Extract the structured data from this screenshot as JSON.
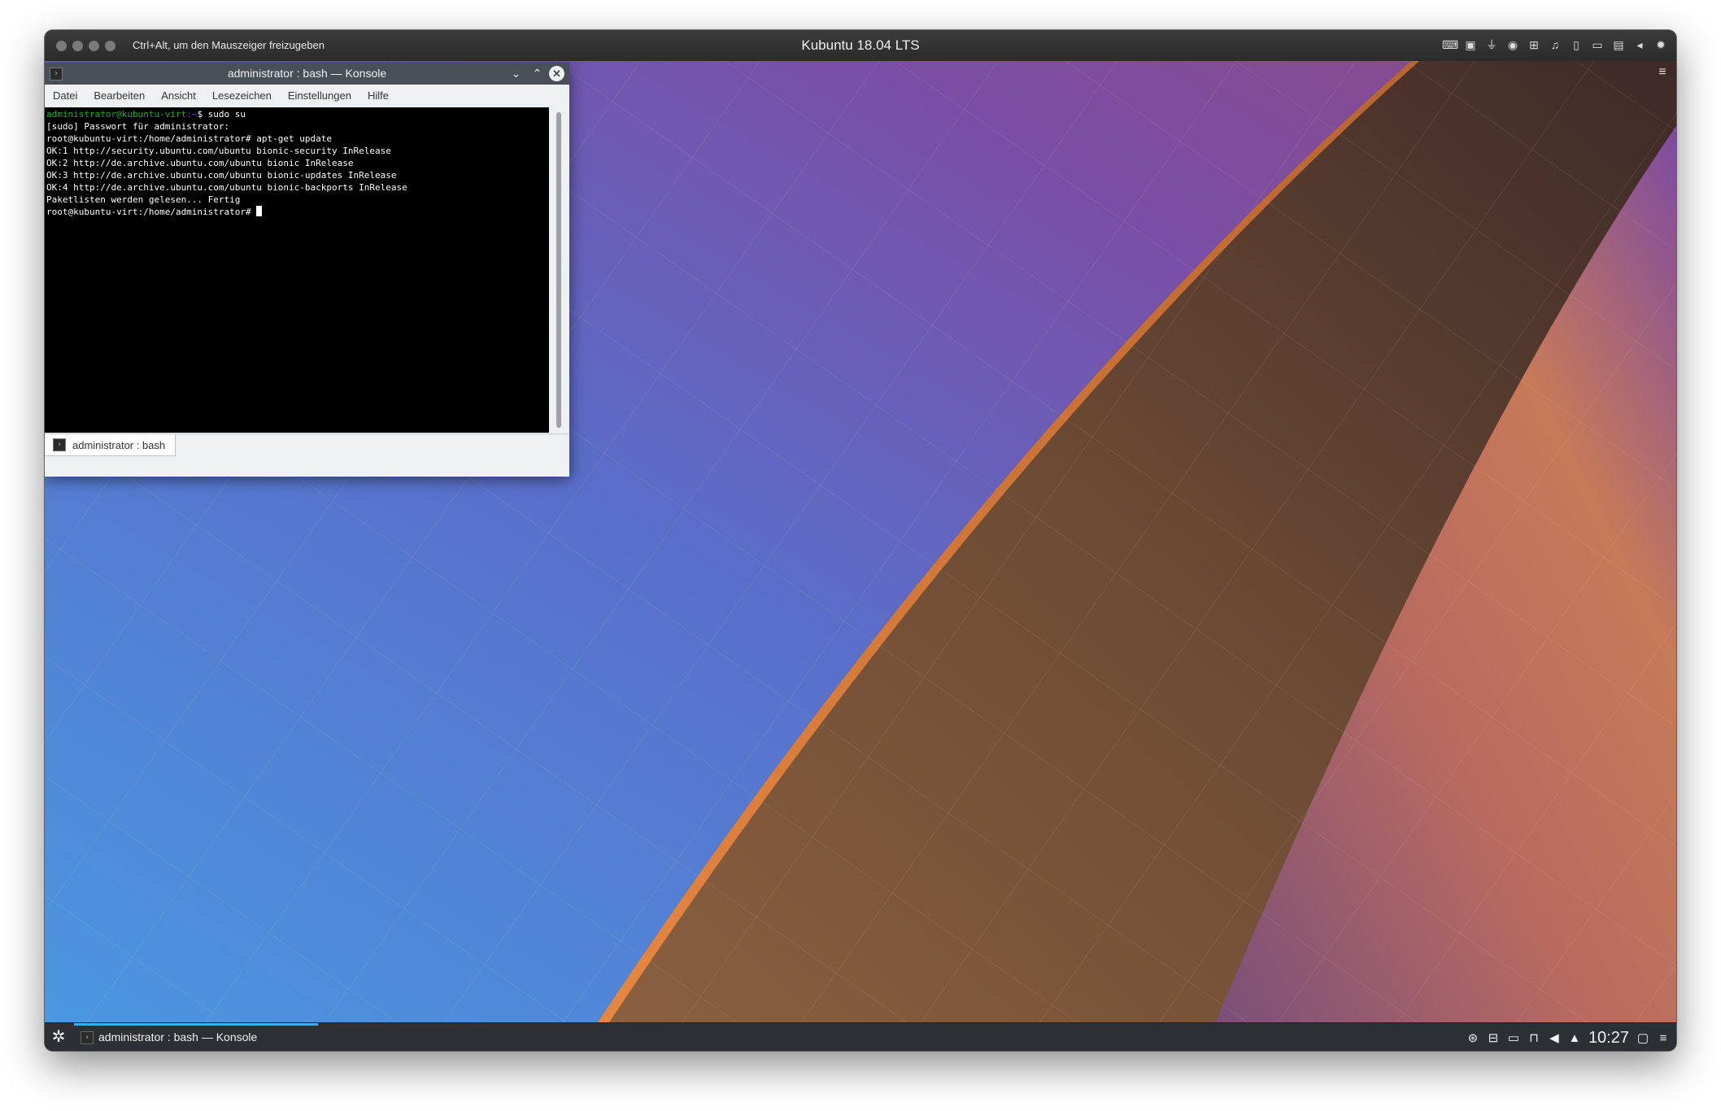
{
  "vm": {
    "hint": "Ctrl+Alt, um den Mauszeiger freizugeben",
    "title": "Kubuntu 18.04 LTS",
    "toolbar_icons": [
      "keyboard-icon",
      "cpu-icon",
      "usb-icon",
      "optical-disc-icon",
      "network-icon",
      "audio-icon",
      "phone-icon",
      "camera-icon",
      "shared-folder-icon",
      "back-icon",
      "settings-gear-icon"
    ]
  },
  "konsole": {
    "title": "administrator : bash — Konsole",
    "menu": [
      "Datei",
      "Bearbeiten",
      "Ansicht",
      "Lesezeichen",
      "Einstellungen",
      "Hilfe"
    ],
    "prompt_user": "administrator@kubuntu-virt",
    "prompt_path": ":~",
    "first_command": "$ sudo su",
    "lines": [
      "[sudo] Passwort für administrator:",
      "root@kubuntu-virt:/home/administrator# apt-get update",
      "OK:1 http://security.ubuntu.com/ubuntu bionic-security InRelease",
      "OK:2 http://de.archive.ubuntu.com/ubuntu bionic InRelease",
      "OK:3 http://de.archive.ubuntu.com/ubuntu bionic-updates InRelease",
      "OK:4 http://de.archive.ubuntu.com/ubuntu bionic-backports InRelease",
      "Paketlisten werden gelesen... Fertig"
    ],
    "last_prompt": "root@kubuntu-virt:/home/administrator# ",
    "tab_label": "administrator : bash"
  },
  "taskbar": {
    "task_label": "administrator : bash — Konsole",
    "clock": "10:27",
    "tray_icons": [
      "update-icon",
      "usb-device-icon",
      "display-icon",
      "lock-icon",
      "volume-icon",
      "expand-tray-icon"
    ]
  },
  "colors": {
    "konsole_titlebar": "#475057",
    "taskbar": "#2c3034",
    "accent": "#3daee9",
    "prompt_green": "#18b218"
  }
}
